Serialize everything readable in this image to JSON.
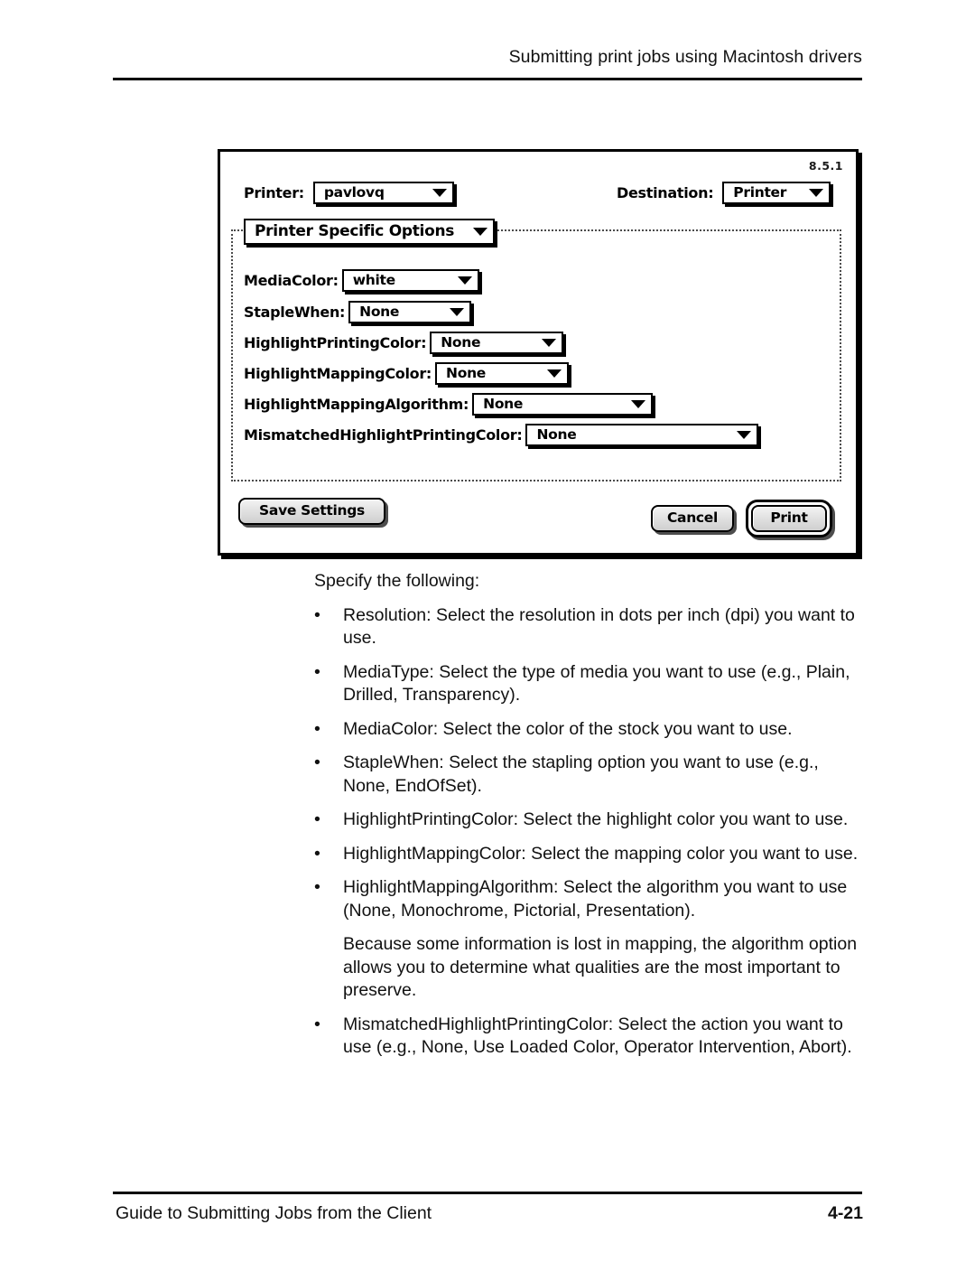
{
  "page": {
    "header_title": "Submitting print jobs using Macintosh drivers",
    "footer_left": "Guide to Submitting Jobs from the Client",
    "footer_page": "4-21"
  },
  "dialog": {
    "version": "8.5.1",
    "printer_label": "Printer:",
    "printer_value": "pavlovq",
    "destination_label": "Destination:",
    "destination_value": "Printer",
    "pane_popup_value": "Printer Specific Options",
    "fields": [
      {
        "label": "MediaColor:",
        "value": "white"
      },
      {
        "label": "StapleWhen:",
        "value": "None"
      },
      {
        "label": "HighlightPrintingColor:",
        "value": "None"
      },
      {
        "label": "HighlightMappingColor:",
        "value": "None"
      },
      {
        "label": "HighlightMappingAlgorithm:",
        "value": "None"
      },
      {
        "label": "MismatchedHighlightPrintingColor:",
        "value": "None"
      }
    ],
    "buttons": {
      "save_settings": "Save Settings",
      "cancel": "Cancel",
      "print": "Print"
    }
  },
  "body": {
    "intro": "Specify the following:",
    "bullet_char": "•",
    "bullets": [
      "Resolution: Select the resolution in dots per inch (dpi) you want to use.",
      "MediaType: Select the type of media you want to use (e.g., Plain, Drilled, Transparency).",
      "MediaColor: Select the color of the stock you want to use.",
      "StapleWhen: Select the stapling option you want to use (e.g., None, EndOfSet).",
      "HighlightPrintingColor: Select the highlight color you want to use.",
      "HighlightMappingColor: Select the mapping color you want to use.",
      "HighlightMappingAlgorithm: Select the algorithm you want to use (None, Monochrome, Pictorial, Presentation)."
    ],
    "note": "Because some information is lost in mapping, the algorithm option allows you to determine what qualities are the most important to preserve.",
    "last_bullet": "MismatchedHighlightPrintingColor: Select the action you want to use (e.g., None, Use Loaded Color, Operator Intervention, Abort)."
  },
  "colors": {
    "ink": "#000000",
    "paper": "#ffffff",
    "button_face": "#e2e2e2"
  }
}
